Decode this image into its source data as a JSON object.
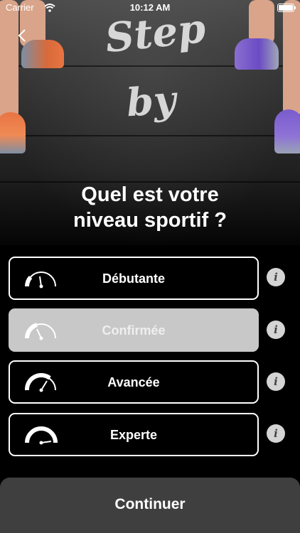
{
  "status_bar": {
    "carrier": "Carrier",
    "time": "10:12 AM"
  },
  "hero": {
    "chalk_text_1": "Step",
    "chalk_text_2": "by"
  },
  "title_line_1": "Quel est votre",
  "title_line_2": "niveau sportif ?",
  "levels": [
    {
      "label": "Débutante",
      "selected": false
    },
    {
      "label": "Confirmée",
      "selected": true
    },
    {
      "label": "Avancée",
      "selected": false
    },
    {
      "label": "Experte",
      "selected": false
    }
  ],
  "info_glyph": "i",
  "continue_label": "Continuer",
  "colors": {
    "background": "#000000",
    "selected_fill": "#c8c8c8",
    "button_fill": "#3f3f3f"
  }
}
